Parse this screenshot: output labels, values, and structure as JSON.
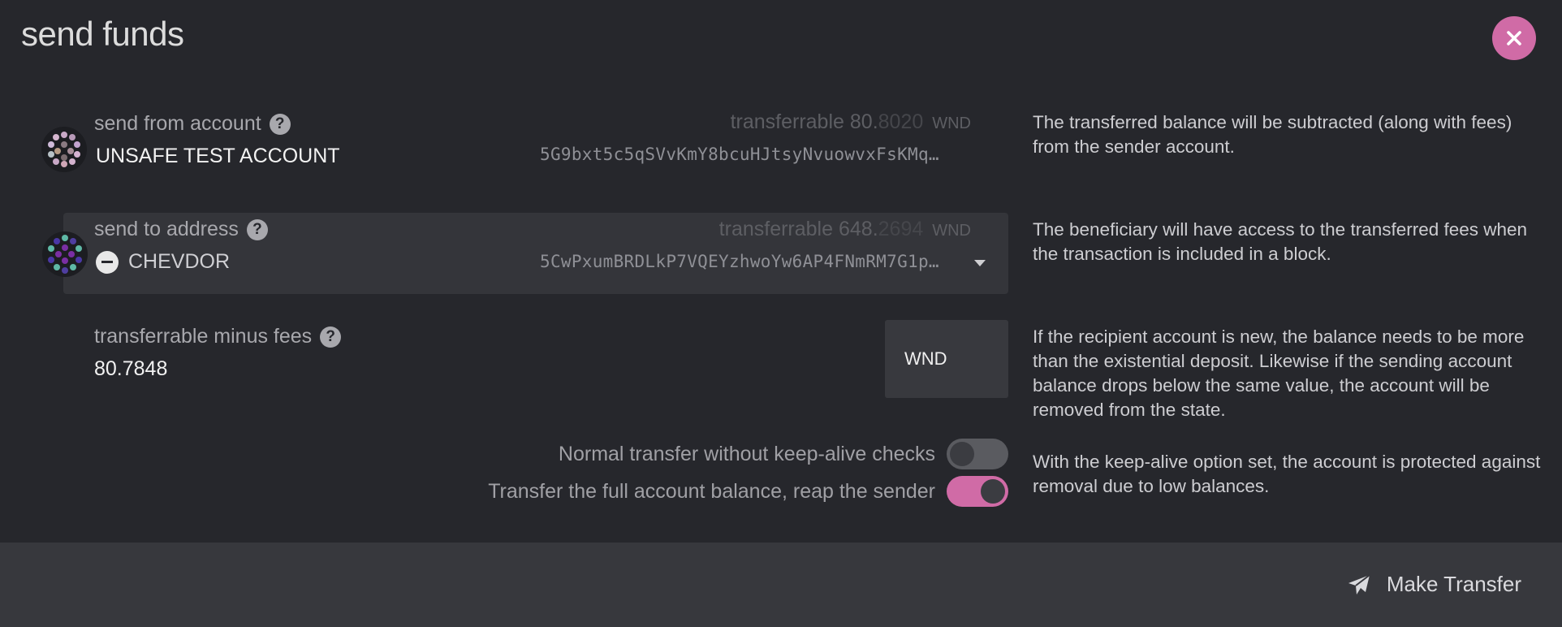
{
  "modal": {
    "title": "send funds"
  },
  "from": {
    "label": "send from account",
    "account_name": "UNSAFE TEST ACCOUNT",
    "transferrable_label": "transferrable",
    "balance_int": "80.",
    "balance_dec": "8020",
    "unit": "WND",
    "address": "5G9bxt5c5qSVvKmY8bcuHJtsyNvuowvxFsKMq…",
    "help": "The transferred balance will be subtracted (along with fees) from the sender account."
  },
  "to": {
    "label": "send to address",
    "account_name": "CHEVDOR",
    "transferrable_label": "transferrable",
    "balance_int": "648.",
    "balance_dec": "2694",
    "unit": "WND",
    "address": "5CwPxumBRDLkP7VQEYzhwoYw6AP4FNmRM7G1p…",
    "help": "The beneficiary will have access to the transferred fees when the transaction is included in a block."
  },
  "amount": {
    "label": "transferrable minus fees",
    "value": "80.7848",
    "unit": "WND",
    "help": "If the recipient account is new, the balance needs to be more than the existential deposit. Likewise if the sending account balance drops below the same value, the account will be removed from the state."
  },
  "options": {
    "keep_alive_label": "Normal transfer without keep-alive checks",
    "keep_alive_on": false,
    "full_balance_label": "Transfer the full account balance, reap the sender",
    "full_balance_on": true,
    "help": "With the keep-alive option set, the account is protected against removal due to low balances."
  },
  "footer": {
    "make_transfer_label": "Make Transfer"
  },
  "colors": {
    "accent": "#d06ba6",
    "background": "#26272c",
    "footer": "#37383d"
  }
}
